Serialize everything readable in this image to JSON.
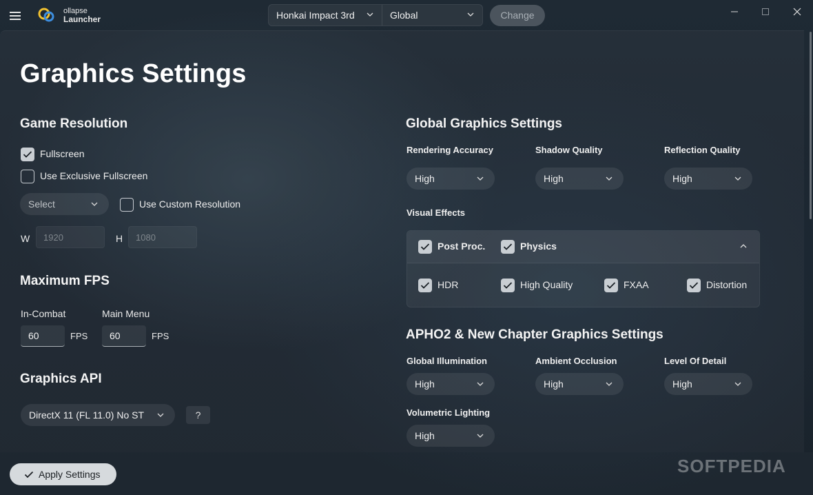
{
  "app": {
    "logo_line1": "ollapse",
    "logo_line2": "Launcher"
  },
  "header": {
    "game": "Honkai Impact 3rd",
    "region": "Global",
    "change_label": "Change"
  },
  "page": {
    "title": "Graphics Settings"
  },
  "resolution": {
    "heading": "Game Resolution",
    "fullscreen_label": "Fullscreen",
    "fullscreen_checked": true,
    "exclusive_label": "Use Exclusive Fullscreen",
    "exclusive_checked": false,
    "preset_value": "Select",
    "custom_label": "Use Custom Resolution",
    "custom_checked": false,
    "w_label": "W",
    "w_value": "1920",
    "h_label": "H",
    "h_value": "1080"
  },
  "fps": {
    "heading": "Maximum FPS",
    "combat_label": "In-Combat",
    "combat_value": "60",
    "menu_label": "Main Menu",
    "menu_value": "60",
    "unit": "FPS"
  },
  "api": {
    "heading": "Graphics API",
    "value": "DirectX 11 (FL 11.0) No ST",
    "help": "?"
  },
  "global_graphics": {
    "heading": "Global Graphics Settings",
    "rendering_label": "Rendering Accuracy",
    "rendering_value": "High",
    "shadow_label": "Shadow Quality",
    "shadow_value": "High",
    "reflection_label": "Reflection Quality",
    "reflection_value": "High",
    "visual_effects_label": "Visual Effects",
    "effects": {
      "postproc": "Post Proc.",
      "physics": "Physics",
      "hdr": "HDR",
      "high_quality": "High Quality",
      "fxaa": "FXAA",
      "distortion": "Distortion"
    }
  },
  "apho2": {
    "heading": "APHO2 & New Chapter Graphics Settings",
    "gi_label": "Global Illumination",
    "gi_value": "High",
    "ao_label": "Ambient Occlusion",
    "ao_value": "High",
    "lod_label": "Level Of Detail",
    "lod_value": "High",
    "vol_label": "Volumetric Lighting",
    "vol_value": "High"
  },
  "footer": {
    "apply_label": "Apply Settings",
    "watermark": "SOFTPEDIA"
  },
  "colors": {
    "checkbox_fill": "#c9ced3",
    "apply_button": "#d6dadd",
    "change_button": "#4b545d"
  }
}
